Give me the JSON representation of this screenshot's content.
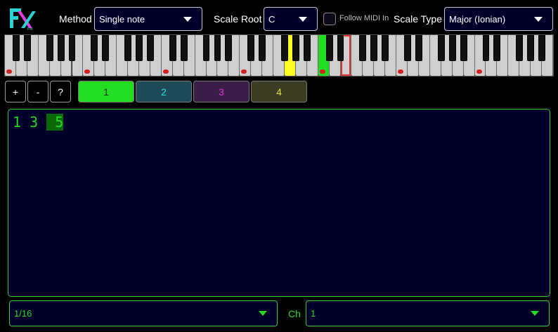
{
  "topbar": {
    "method_label": "Method",
    "method_value": "Single note",
    "scale_root_label": "Scale Root",
    "scale_root_value": "C",
    "follow_midi_label": "Follow MIDI In",
    "scale_type_label": "Scale Type",
    "scale_type_value": "Major (Ionian)"
  },
  "keyboard": {
    "octaves": 7,
    "highlighted_keys": [
      {
        "key": "G4",
        "color": "#ffff22"
      },
      {
        "key": "C5",
        "color": "#22dd22"
      }
    ],
    "outlined_key": {
      "key": "E5",
      "color": "#e03030"
    },
    "c_marker_color": "#d42020"
  },
  "toolbar": {
    "add_label": "+",
    "remove_label": "-",
    "help_label": "?",
    "tabs": [
      {
        "label": "1",
        "bg": "#22dd22",
        "fg": "#003300"
      },
      {
        "label": "2",
        "bg": "#1e4a58",
        "fg": "#22e0e0"
      },
      {
        "label": "3",
        "bg": "#3a1e48",
        "fg": "#e030e0"
      },
      {
        "label": "4",
        "bg": "#3c3c24",
        "fg": "#e8e030"
      }
    ]
  },
  "sequence": {
    "prefix": "1 3 ",
    "highlighted": " 5"
  },
  "bottombar": {
    "division_value": "1/16",
    "channel_label": "Ch",
    "channel_value": "1"
  },
  "colors": {
    "accent_green": "#22dd22",
    "panel_bg": "#00002b"
  }
}
